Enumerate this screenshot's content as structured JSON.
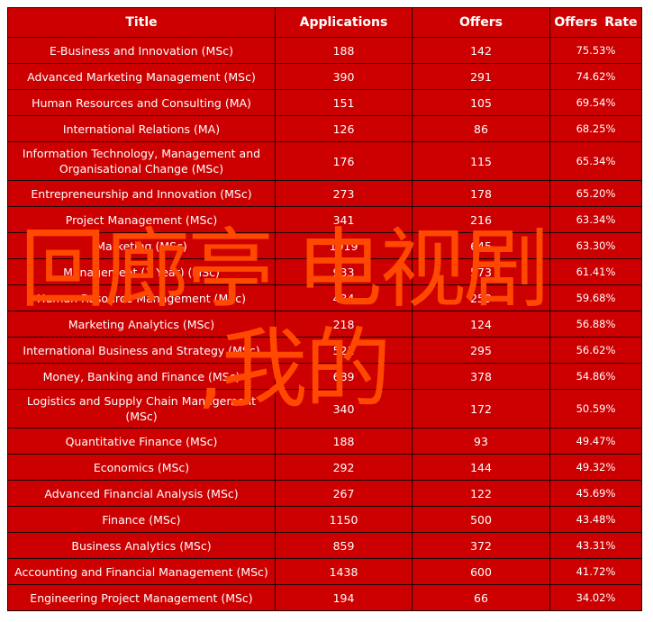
{
  "table": {
    "headers": [
      "Title",
      "Applications",
      "Offers",
      "Offers  Rate"
    ],
    "rows": [
      {
        "title": "E-Business and Innovation (MSc)",
        "applications": "188",
        "offers": "142",
        "rate": "75.53%"
      },
      {
        "title": "Advanced Marketing Management (MSc)",
        "applications": "390",
        "offers": "291",
        "rate": "74.62%"
      },
      {
        "title": "Human Resources and Consulting (MA)",
        "applications": "151",
        "offers": "105",
        "rate": "69.54%"
      },
      {
        "title": "International Relations (MA)",
        "applications": "126",
        "offers": "86",
        "rate": "68.25%"
      },
      {
        "title": "Information Technology, Management and Organisational Change (MSc)",
        "applications": "176",
        "offers": "115",
        "rate": "65.34%"
      },
      {
        "title": "Entrepreneurship and Innovation (MSc)",
        "applications": "273",
        "offers": "178",
        "rate": "65.20%"
      },
      {
        "title": "Project Management (MSc)",
        "applications": "341",
        "offers": "216",
        "rate": "63.34%"
      },
      {
        "title": "Marketing (MSc)",
        "applications": "1019",
        "offers": "645",
        "rate": "63.30%"
      },
      {
        "title": "Management (1 Year) (MSc)",
        "applications": "933",
        "offers": "573",
        "rate": "61.41%"
      },
      {
        "title": "Human Resource Management (MSc)",
        "applications": "434",
        "offers": "259",
        "rate": "59.68%"
      },
      {
        "title": "Marketing Analytics (MSc)",
        "applications": "218",
        "offers": "124",
        "rate": "56.88%"
      },
      {
        "title": "International Business and Strategy (MSc)",
        "applications": "521",
        "offers": "295",
        "rate": "56.62%"
      },
      {
        "title": "Money, Banking and Finance (MSc)",
        "applications": "689",
        "offers": "378",
        "rate": "54.86%"
      },
      {
        "title": "Logistics and Supply Chain Management (MSc)",
        "applications": "340",
        "offers": "172",
        "rate": "50.59%"
      },
      {
        "title": "Quantitative Finance (MSc)",
        "applications": "188",
        "offers": "93",
        "rate": "49.47%"
      },
      {
        "title": "Economics (MSc)",
        "applications": "292",
        "offers": "144",
        "rate": "49.32%"
      },
      {
        "title": "Advanced Financial Analysis (MSc)",
        "applications": "267",
        "offers": "122",
        "rate": "45.69%"
      },
      {
        "title": "Finance (MSc)",
        "applications": "1150",
        "offers": "500",
        "rate": "43.48%"
      },
      {
        "title": "Business Analytics (MSc)",
        "applications": "859",
        "offers": "372",
        "rate": "43.31%"
      },
      {
        "title": "Accounting and Financial Management (MSc)",
        "applications": "1438",
        "offers": "600",
        "rate": "41.72%"
      },
      {
        "title": "Engineering Project Management (MSc)",
        "applications": "194",
        "offers": "66",
        "rate": "34.02%"
      }
    ]
  },
  "overlay": {
    "line1": "回廊亭 电视剧",
    "line2": ",我的"
  },
  "colors": {
    "table_background": "#cc0000",
    "text": "#ffffff",
    "overlay_text": "#ff4800",
    "border": "#1a0000"
  }
}
